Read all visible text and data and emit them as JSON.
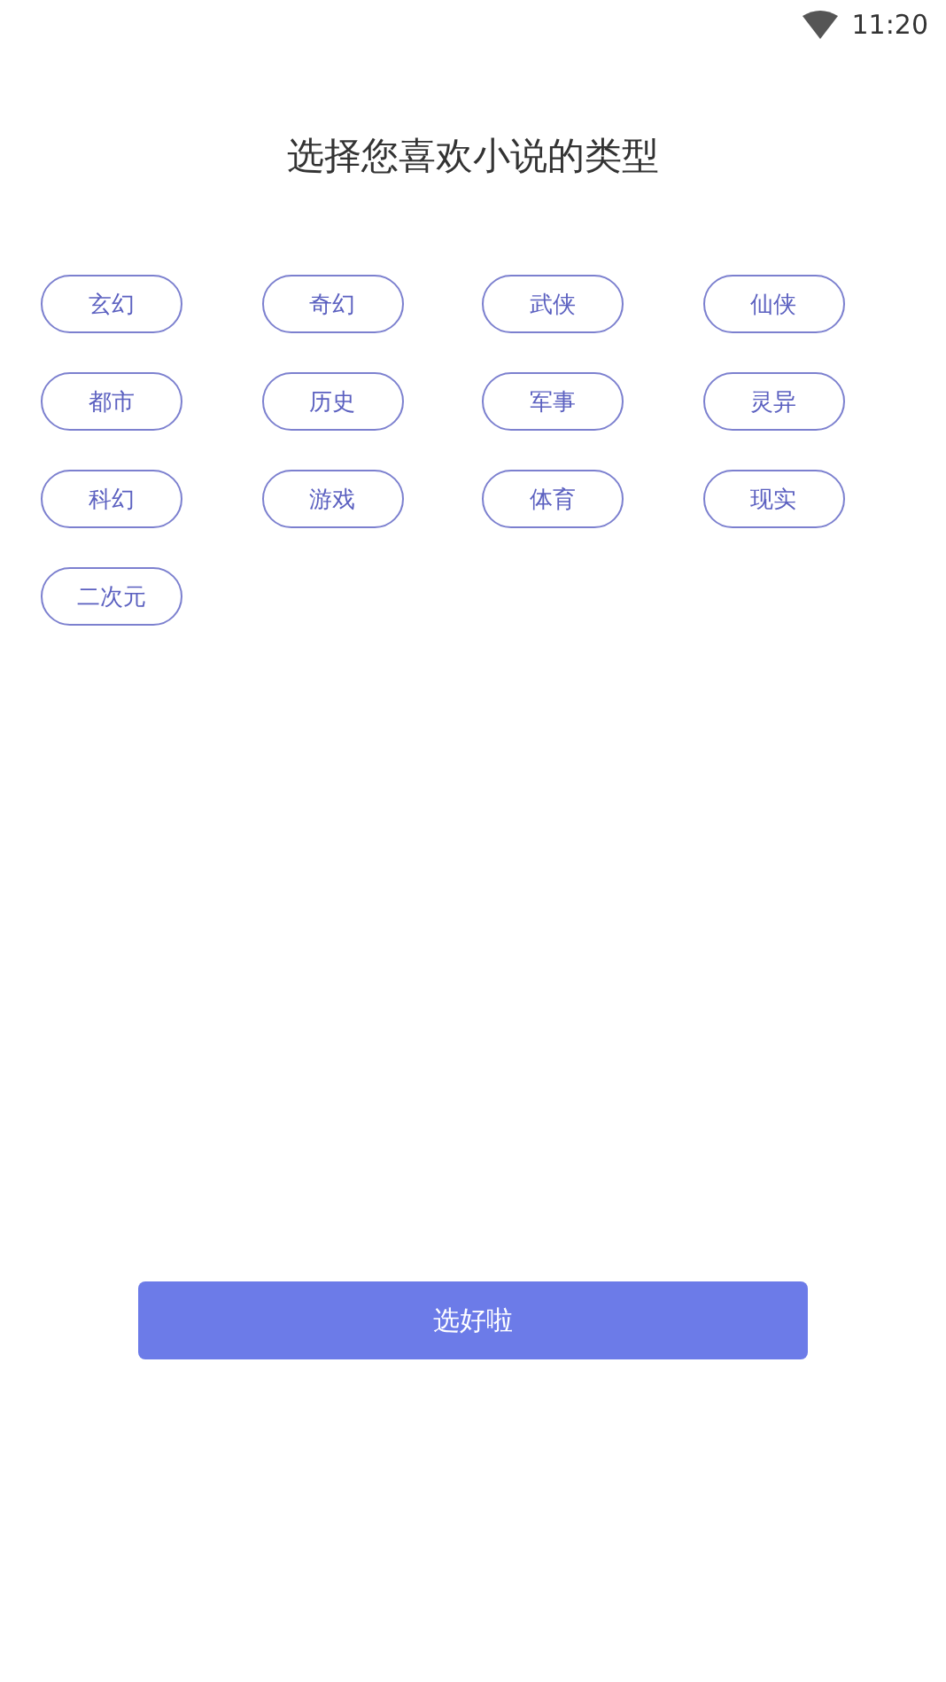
{
  "status_bar": {
    "time": "11:20"
  },
  "title": "选择您喜欢小说的类型",
  "genres": [
    "玄幻",
    "奇幻",
    "武侠",
    "仙侠",
    "都市",
    "历史",
    "军事",
    "灵异",
    "科幻",
    "游戏",
    "体育",
    "现实",
    "二次元"
  ],
  "confirm_button": "选好啦"
}
